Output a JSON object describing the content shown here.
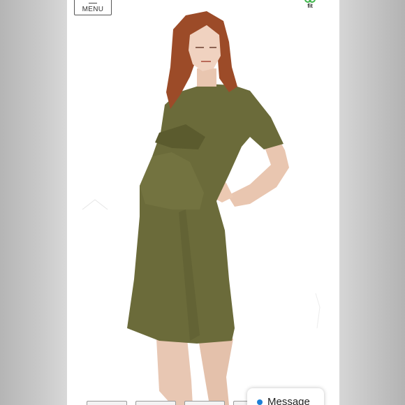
{
  "header": {
    "menu_label": "MENU",
    "fit_label": "fit"
  },
  "product": {
    "dress_color": "#6b6b3a",
    "background": "#ffffff"
  },
  "chat": {
    "label": "Message",
    "dot_color": "#1e7fd6"
  },
  "thumbnails": {
    "count": 4
  }
}
